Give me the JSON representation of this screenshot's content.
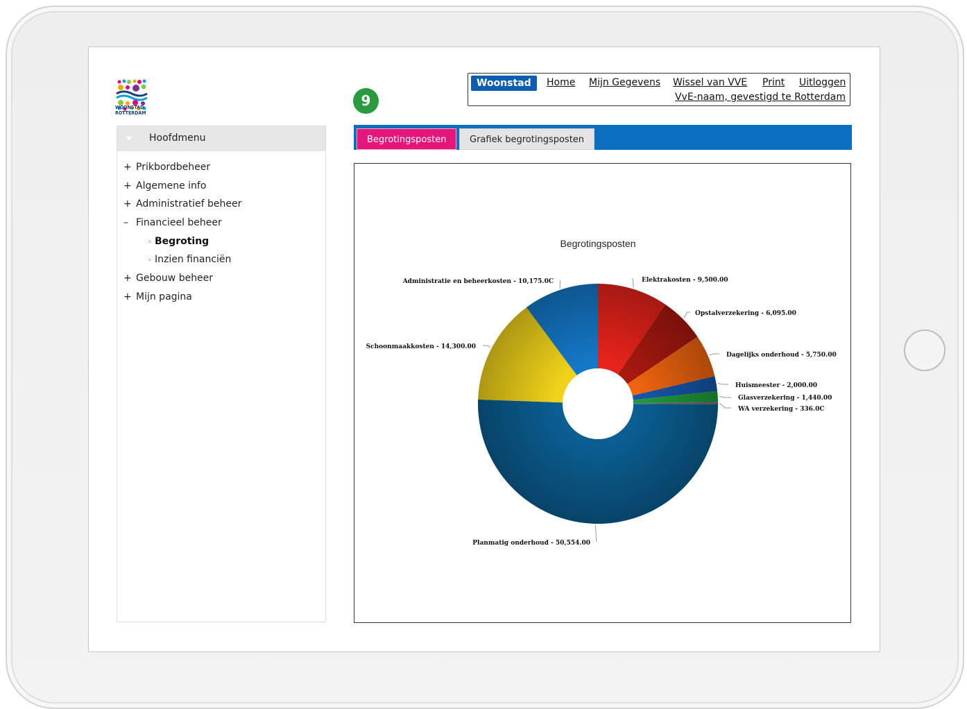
{
  "brand": {
    "logo_text_line1": "WOONSTAD",
    "logo_text_line2": "ROTTERDAM"
  },
  "step_badge": "9",
  "topnav": {
    "brand_label": "Woonstad",
    "links": [
      "Home",
      "Mijn Gegevens",
      "Wissel van VVE",
      "Print",
      "Uitloggen"
    ],
    "vve_label": "VvE-naam, gevestigd te Rotterdam"
  },
  "sidebar": {
    "title": "Hoofdmenu",
    "items": [
      {
        "mark": "+",
        "label": "Prikbordbeheer"
      },
      {
        "mark": "+",
        "label": "Algemene info"
      },
      {
        "mark": "+",
        "label": "Administratief beheer"
      },
      {
        "mark": "–",
        "label": "Financieel beheer"
      },
      {
        "mark": "◦",
        "label": "Begroting",
        "sub": true,
        "active": true
      },
      {
        "mark": "◦",
        "label": "Inzien financiën",
        "sub": true
      },
      {
        "mark": "+",
        "label": "Gebouw beheer"
      },
      {
        "mark": "+",
        "label": "Mijn pagina"
      }
    ]
  },
  "tabs": [
    {
      "label": "Begrotingsposten",
      "active": true
    },
    {
      "label": "Grafiek begrotingsposten",
      "active": false
    }
  ],
  "colors": {
    "accent_blue": "#0a6fc0",
    "tab_active": "#e5167a",
    "badge": "#2a9a3e"
  },
  "chart_data": {
    "type": "pie",
    "donut": true,
    "title": "Begrotingsposten",
    "slices": [
      {
        "label": "Elektrakosten - 9,500.00",
        "value": 9500,
        "color": "#e8231b"
      },
      {
        "label": "Opstalverzekering - 6,095.00",
        "value": 6095,
        "color": "#a8190f"
      },
      {
        "label": "Dagelijks onderhoud - 5,750.00",
        "value": 5750,
        "color": "#f0640f"
      },
      {
        "label": "Huismeester - 2,000.00",
        "value": 2000,
        "color": "#1656a8"
      },
      {
        "label": "Glasverzekering - 1,440.00",
        "value": 1440,
        "color": "#1f9a3a"
      },
      {
        "label": "WA verzekering - 336.0C",
        "value": 336,
        "color": "#6e6e6e"
      },
      {
        "label": "Planmatig onderhoud - 50,554.00",
        "value": 50554,
        "color": "#0b5e92"
      },
      {
        "label": "Schoonmaakkosten - 14,300.00",
        "value": 14300,
        "color": "#f0d21a"
      },
      {
        "label": "Administratie en beheerkosten - 10,175.0C",
        "value": 10175,
        "color": "#1478c8"
      }
    ]
  }
}
